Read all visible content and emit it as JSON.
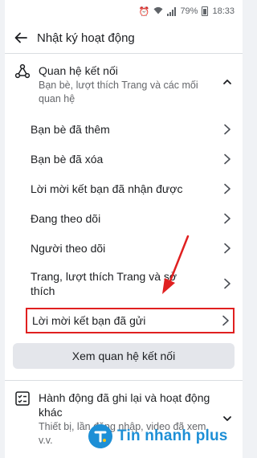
{
  "status_bar": {
    "battery": "79%",
    "time": "18:33"
  },
  "header": {
    "title": "Nhật ký hoạt động"
  },
  "section1": {
    "title": "Quan hệ kết nối",
    "subtitle": "Bạn bè, lượt thích Trang và các mối quan hệ",
    "items": [
      {
        "label": "Bạn bè đã thêm"
      },
      {
        "label": "Bạn bè đã xóa"
      },
      {
        "label": "Lời mời kết bạn đã nhận được"
      },
      {
        "label": "Đang theo dõi"
      },
      {
        "label": "Người theo dõi"
      },
      {
        "label": "Trang, lượt thích Trang và sở thích"
      },
      {
        "label": "Lời mời kết bạn đã gửi"
      }
    ],
    "button": "Xem quan hệ kết nối"
  },
  "section2": {
    "title": "Hành động đã ghi lại và hoạt động khác",
    "subtitle": "Thiết bị, lần đăng nhập, video đã xem, v.v."
  },
  "watermark": {
    "text": "Tin nhanh plus"
  },
  "colors": {
    "highlight": "#e02020",
    "brand": "#1d8fd6"
  }
}
